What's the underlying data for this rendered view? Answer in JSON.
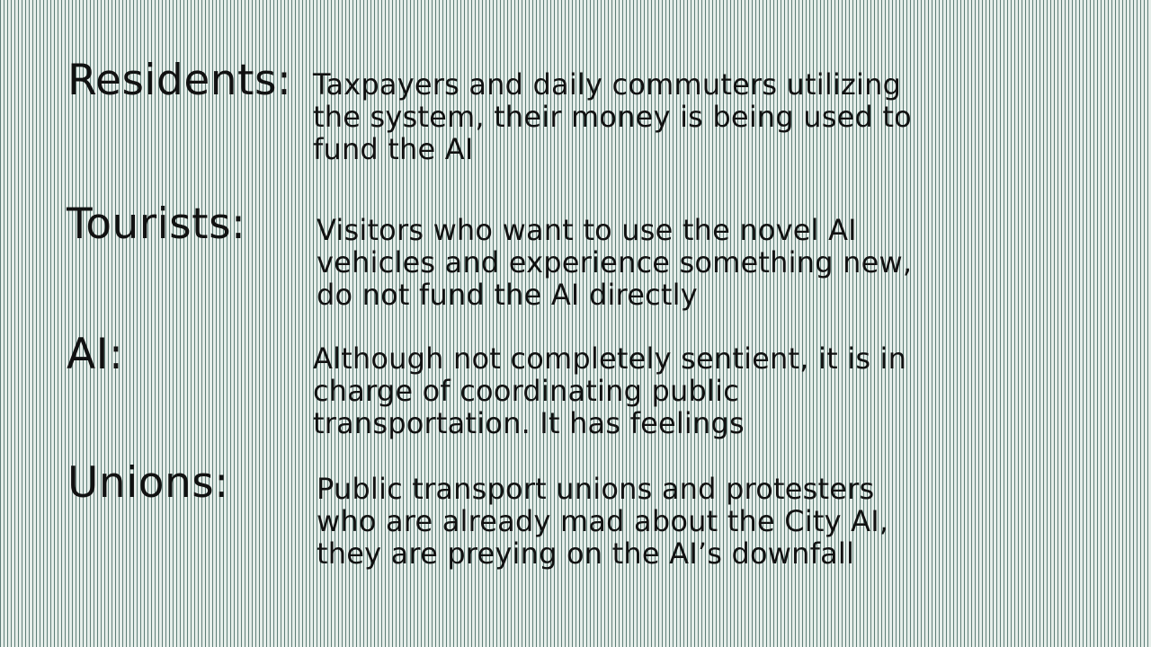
{
  "stakeholders": [
    {
      "term": "Residents:",
      "description": "Taxpayers and daily commuters utilizing\nthe system, their money is being used to\nfund the AI"
    },
    {
      "term": "Tourists:",
      "description": "Visitors who want to use the novel AI\nvehicles and experience something new,\ndo not fund the AI directly"
    },
    {
      "term": "AI:",
      "description": "Although not completely sentient, it is in\ncharge of coordinating public\ntransportation. It has feelings"
    },
    {
      "term": "Unions:",
      "description": "Public transport unions and protesters\nwho are already mad about the City AI,\nthey are preying on the AI’s downfall"
    }
  ]
}
